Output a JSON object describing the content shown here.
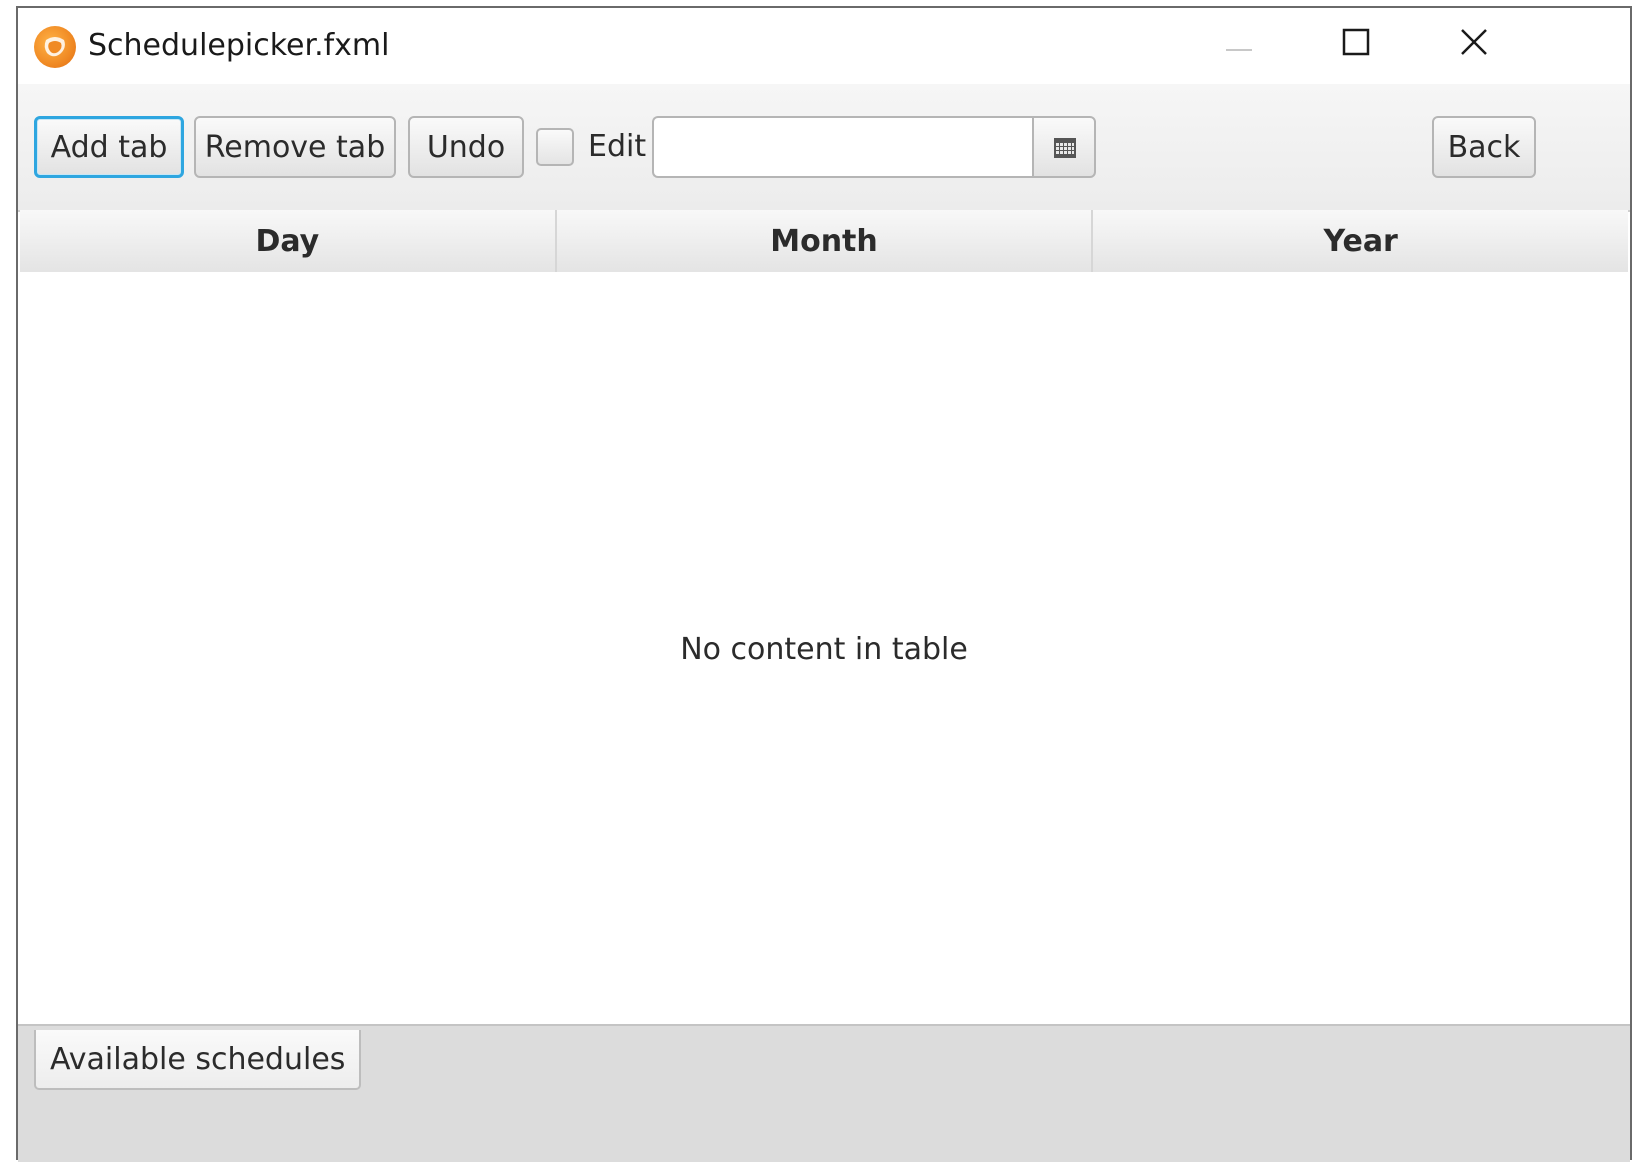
{
  "window": {
    "title": "Schedulepicker.fxml",
    "controls": {
      "minimize": "minimize-icon",
      "maximize": "maximize-icon",
      "close": "close-icon"
    }
  },
  "toolbar": {
    "add_tab_label": "Add tab",
    "remove_tab_label": "Remove tab",
    "undo_label": "Undo",
    "edit_checkbox_label": "Edit",
    "edit_checked": false,
    "date_input_value": "",
    "date_picker_icon": "calendar-icon",
    "back_label": "Back"
  },
  "table": {
    "columns": [
      "Day",
      "Month",
      "Year"
    ],
    "placeholder": "No content in table"
  },
  "tabs": [
    {
      "label": "Available schedules",
      "selected": true
    }
  ],
  "colors": {
    "focus_accent": "#2ea6e0",
    "app_icon": "#f08a24"
  }
}
